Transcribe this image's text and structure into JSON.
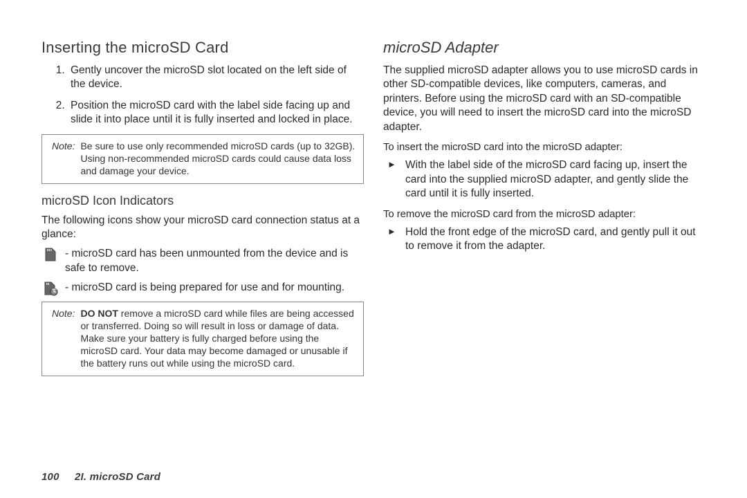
{
  "left": {
    "heading1": "Inserting the microSD Card",
    "steps": [
      "Gently uncover the microSD slot located on the left side of the device.",
      "Position the microSD card with the label side facing up and slide it into place until it is fully inserted and locked in place."
    ],
    "note1_label": "Note:",
    "note1_text": "Be sure to use only recommended microSD cards (up to 32GB). Using non-recommended microSD cards could cause data loss and damage your device.",
    "heading2": "microSD Icon Indicators",
    "intro": "The following icons show your microSD card connection status at a glance:",
    "icon1_text": " - microSD card has been unmounted from the device and is safe to remove.",
    "icon2_text": " - microSD card is being prepared for use and for mounting.",
    "note2_label": "Note:",
    "note2_donot": "DO NOT",
    "note2_rest": " remove a microSD card while files are being accessed or transferred. Doing so will result in loss or damage of data. Make sure your battery is fully charged before using the microSD card. Your data may become damaged or unusable if the battery runs out while using the microSD card."
  },
  "right": {
    "heading": "microSD Adapter",
    "para": "The supplied microSD adapter allows you to use microSD cards in other SD-compatible devices, like computers, cameras, and printers. Before using the microSD card with an SD-compatible device, you will need to insert the microSD card into the microSD adapter.",
    "lead1": "To insert the microSD card into the microSD adapter:",
    "bullet1": "With the label side of the microSD card facing up, insert the card into the supplied microSD adapter, and gently slide the card until it is fully inserted.",
    "lead2": "To remove the microSD card from the microSD adapter:",
    "bullet2": "Hold the front edge of the microSD card, and gently pull it out to remove it from the adapter."
  },
  "footer": {
    "page_number": "100",
    "section": "2I. microSD Card"
  }
}
